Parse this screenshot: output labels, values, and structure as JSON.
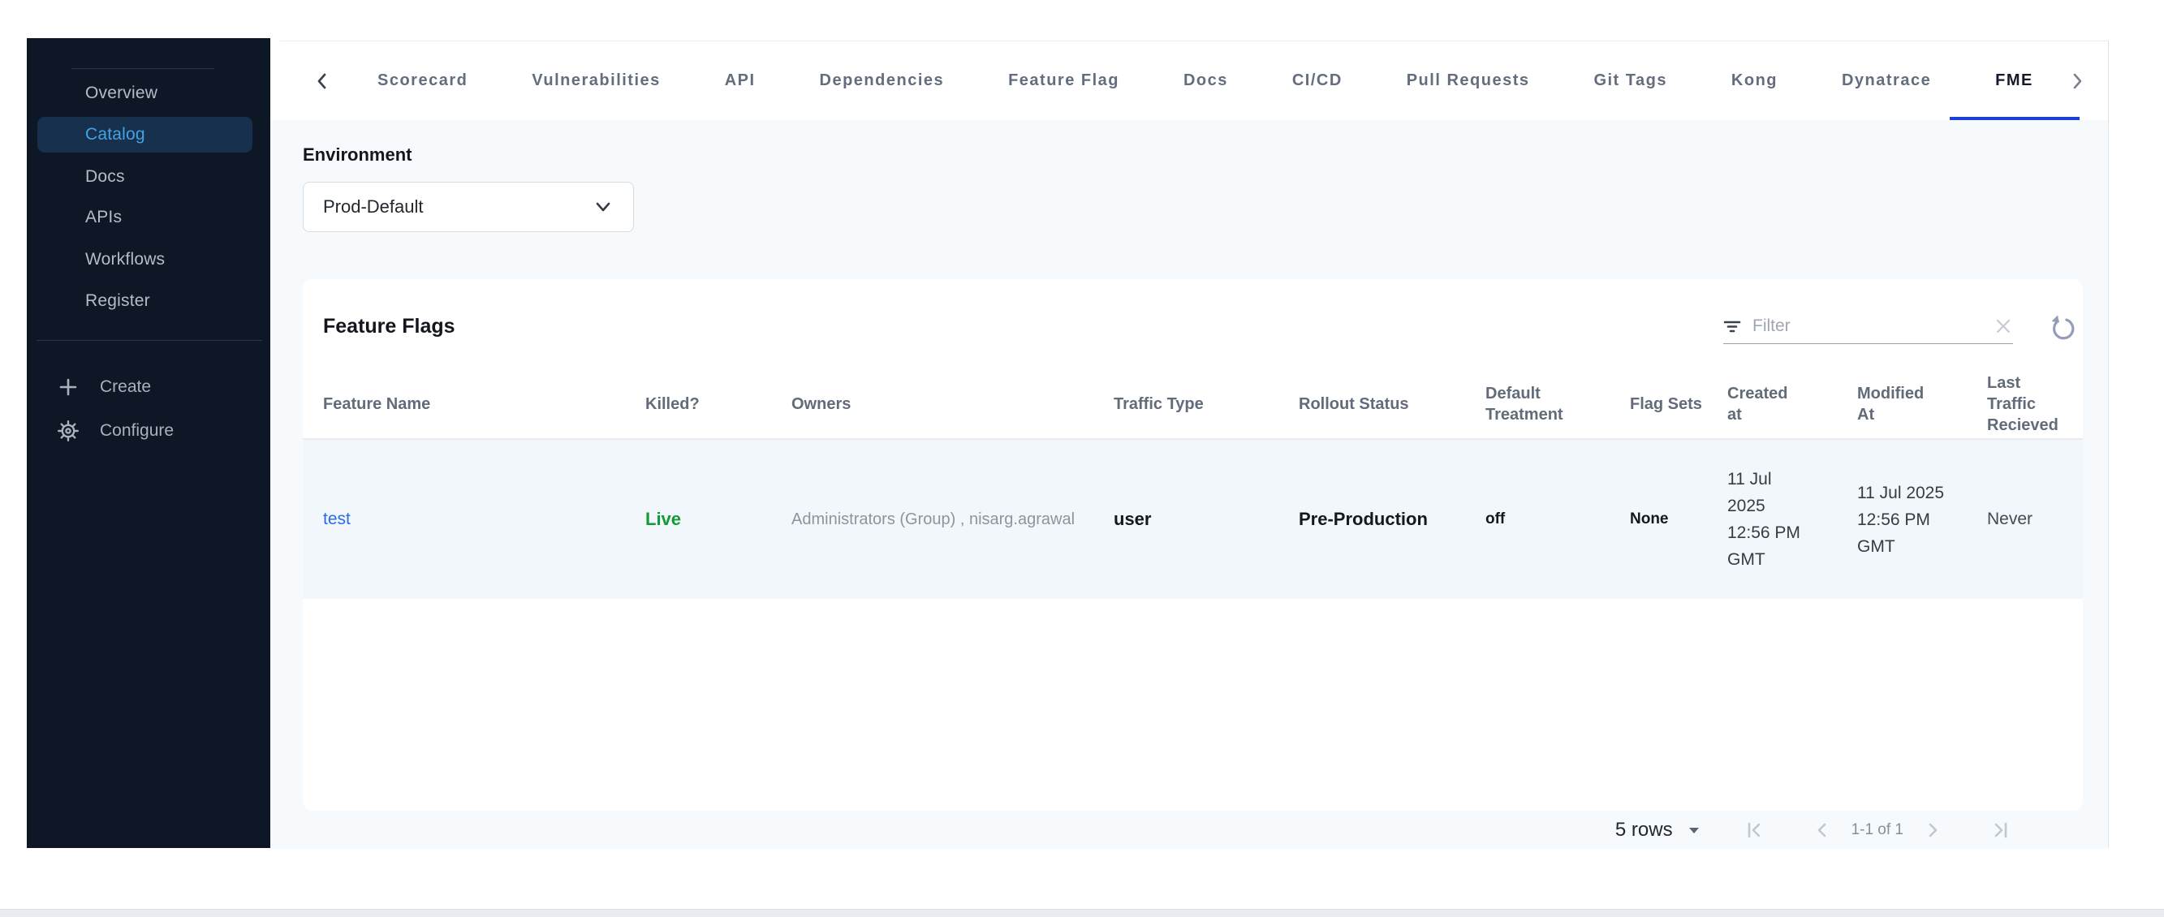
{
  "sidebar": {
    "items": [
      "Overview",
      "Catalog",
      "Docs",
      "APIs",
      "Workflows",
      "Register"
    ],
    "active_item": "Catalog",
    "create_label": "Create",
    "configure_label": "Configure"
  },
  "tabs": {
    "items": [
      "Scorecard",
      "Vulnerabilities",
      "API",
      "Dependencies",
      "Feature Flag",
      "Docs",
      "CI/CD",
      "Pull Requests",
      "Git Tags",
      "Kong",
      "Dynatrace",
      "FME"
    ],
    "active": "FME"
  },
  "environment": {
    "label": "Environment",
    "selected": "Prod-Default"
  },
  "feature_flags_panel": {
    "title": "Feature Flags",
    "filter_placeholder": "Filter",
    "table": {
      "columns": [
        "Feature Name",
        "Killed?",
        "Owners",
        "Traffic Type",
        "Rollout Status",
        "Default Treatment",
        "Flag Sets",
        "Created at",
        "Modified At",
        "Last Traffic Recieved"
      ],
      "rows": [
        {
          "feature_name": "test",
          "killed": "Live",
          "owners": "Administrators (Group) , nisarg.agrawal",
          "traffic_type": "user",
          "rollout_status": "Pre-Production",
          "default_treatment": "off",
          "flag_sets": "None",
          "created_at": "11 Jul 2025 12:56 PM GMT",
          "modified_at": "11 Jul 2025 12:56 PM GMT",
          "last_traffic_received": "Never"
        }
      ]
    },
    "pagination": {
      "rows_per_page": "5 rows",
      "range": "1-1 of 1"
    }
  },
  "colors": {
    "accent_tab_underline": "#1d40d6",
    "link_blue": "#2a6be8",
    "live_green": "#149a38",
    "sidebar_bg": "#0e1726",
    "sidebar_active_bg": "#16304d",
    "sidebar_active_text": "#44a3e4",
    "content_bg": "#f7fafc",
    "row_bg": "#f2f7fb"
  }
}
